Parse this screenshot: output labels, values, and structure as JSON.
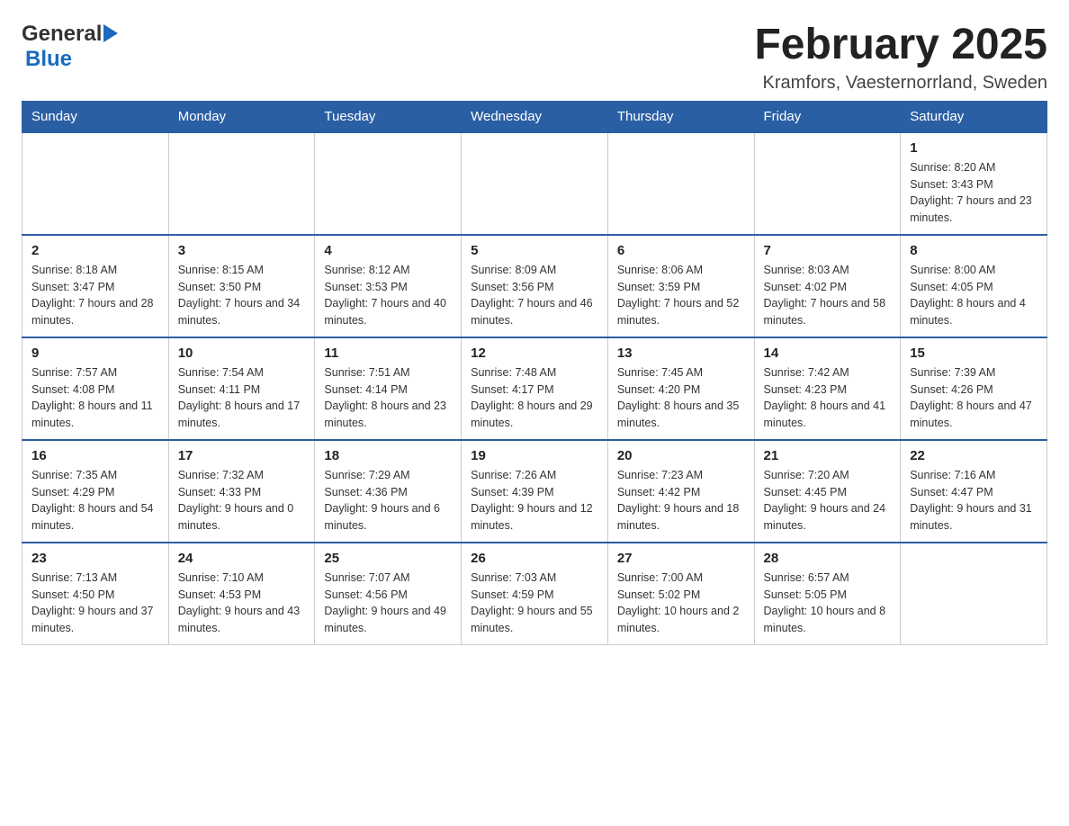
{
  "header": {
    "logo_general": "General",
    "logo_blue": "Blue",
    "month_title": "February 2025",
    "location": "Kramfors, Vaesternorrland, Sweden"
  },
  "weekdays": [
    "Sunday",
    "Monday",
    "Tuesday",
    "Wednesday",
    "Thursday",
    "Friday",
    "Saturday"
  ],
  "weeks": [
    [
      {
        "day": "",
        "sunrise": "",
        "sunset": "",
        "daylight": ""
      },
      {
        "day": "",
        "sunrise": "",
        "sunset": "",
        "daylight": ""
      },
      {
        "day": "",
        "sunrise": "",
        "sunset": "",
        "daylight": ""
      },
      {
        "day": "",
        "sunrise": "",
        "sunset": "",
        "daylight": ""
      },
      {
        "day": "",
        "sunrise": "",
        "sunset": "",
        "daylight": ""
      },
      {
        "day": "",
        "sunrise": "",
        "sunset": "",
        "daylight": ""
      },
      {
        "day": "1",
        "sunrise": "Sunrise: 8:20 AM",
        "sunset": "Sunset: 3:43 PM",
        "daylight": "Daylight: 7 hours and 23 minutes."
      }
    ],
    [
      {
        "day": "2",
        "sunrise": "Sunrise: 8:18 AM",
        "sunset": "Sunset: 3:47 PM",
        "daylight": "Daylight: 7 hours and 28 minutes."
      },
      {
        "day": "3",
        "sunrise": "Sunrise: 8:15 AM",
        "sunset": "Sunset: 3:50 PM",
        "daylight": "Daylight: 7 hours and 34 minutes."
      },
      {
        "day": "4",
        "sunrise": "Sunrise: 8:12 AM",
        "sunset": "Sunset: 3:53 PM",
        "daylight": "Daylight: 7 hours and 40 minutes."
      },
      {
        "day": "5",
        "sunrise": "Sunrise: 8:09 AM",
        "sunset": "Sunset: 3:56 PM",
        "daylight": "Daylight: 7 hours and 46 minutes."
      },
      {
        "day": "6",
        "sunrise": "Sunrise: 8:06 AM",
        "sunset": "Sunset: 3:59 PM",
        "daylight": "Daylight: 7 hours and 52 minutes."
      },
      {
        "day": "7",
        "sunrise": "Sunrise: 8:03 AM",
        "sunset": "Sunset: 4:02 PM",
        "daylight": "Daylight: 7 hours and 58 minutes."
      },
      {
        "day": "8",
        "sunrise": "Sunrise: 8:00 AM",
        "sunset": "Sunset: 4:05 PM",
        "daylight": "Daylight: 8 hours and 4 minutes."
      }
    ],
    [
      {
        "day": "9",
        "sunrise": "Sunrise: 7:57 AM",
        "sunset": "Sunset: 4:08 PM",
        "daylight": "Daylight: 8 hours and 11 minutes."
      },
      {
        "day": "10",
        "sunrise": "Sunrise: 7:54 AM",
        "sunset": "Sunset: 4:11 PM",
        "daylight": "Daylight: 8 hours and 17 minutes."
      },
      {
        "day": "11",
        "sunrise": "Sunrise: 7:51 AM",
        "sunset": "Sunset: 4:14 PM",
        "daylight": "Daylight: 8 hours and 23 minutes."
      },
      {
        "day": "12",
        "sunrise": "Sunrise: 7:48 AM",
        "sunset": "Sunset: 4:17 PM",
        "daylight": "Daylight: 8 hours and 29 minutes."
      },
      {
        "day": "13",
        "sunrise": "Sunrise: 7:45 AM",
        "sunset": "Sunset: 4:20 PM",
        "daylight": "Daylight: 8 hours and 35 minutes."
      },
      {
        "day": "14",
        "sunrise": "Sunrise: 7:42 AM",
        "sunset": "Sunset: 4:23 PM",
        "daylight": "Daylight: 8 hours and 41 minutes."
      },
      {
        "day": "15",
        "sunrise": "Sunrise: 7:39 AM",
        "sunset": "Sunset: 4:26 PM",
        "daylight": "Daylight: 8 hours and 47 minutes."
      }
    ],
    [
      {
        "day": "16",
        "sunrise": "Sunrise: 7:35 AM",
        "sunset": "Sunset: 4:29 PM",
        "daylight": "Daylight: 8 hours and 54 minutes."
      },
      {
        "day": "17",
        "sunrise": "Sunrise: 7:32 AM",
        "sunset": "Sunset: 4:33 PM",
        "daylight": "Daylight: 9 hours and 0 minutes."
      },
      {
        "day": "18",
        "sunrise": "Sunrise: 7:29 AM",
        "sunset": "Sunset: 4:36 PM",
        "daylight": "Daylight: 9 hours and 6 minutes."
      },
      {
        "day": "19",
        "sunrise": "Sunrise: 7:26 AM",
        "sunset": "Sunset: 4:39 PM",
        "daylight": "Daylight: 9 hours and 12 minutes."
      },
      {
        "day": "20",
        "sunrise": "Sunrise: 7:23 AM",
        "sunset": "Sunset: 4:42 PM",
        "daylight": "Daylight: 9 hours and 18 minutes."
      },
      {
        "day": "21",
        "sunrise": "Sunrise: 7:20 AM",
        "sunset": "Sunset: 4:45 PM",
        "daylight": "Daylight: 9 hours and 24 minutes."
      },
      {
        "day": "22",
        "sunrise": "Sunrise: 7:16 AM",
        "sunset": "Sunset: 4:47 PM",
        "daylight": "Daylight: 9 hours and 31 minutes."
      }
    ],
    [
      {
        "day": "23",
        "sunrise": "Sunrise: 7:13 AM",
        "sunset": "Sunset: 4:50 PM",
        "daylight": "Daylight: 9 hours and 37 minutes."
      },
      {
        "day": "24",
        "sunrise": "Sunrise: 7:10 AM",
        "sunset": "Sunset: 4:53 PM",
        "daylight": "Daylight: 9 hours and 43 minutes."
      },
      {
        "day": "25",
        "sunrise": "Sunrise: 7:07 AM",
        "sunset": "Sunset: 4:56 PM",
        "daylight": "Daylight: 9 hours and 49 minutes."
      },
      {
        "day": "26",
        "sunrise": "Sunrise: 7:03 AM",
        "sunset": "Sunset: 4:59 PM",
        "daylight": "Daylight: 9 hours and 55 minutes."
      },
      {
        "day": "27",
        "sunrise": "Sunrise: 7:00 AM",
        "sunset": "Sunset: 5:02 PM",
        "daylight": "Daylight: 10 hours and 2 minutes."
      },
      {
        "day": "28",
        "sunrise": "Sunrise: 6:57 AM",
        "sunset": "Sunset: 5:05 PM",
        "daylight": "Daylight: 10 hours and 8 minutes."
      },
      {
        "day": "",
        "sunrise": "",
        "sunset": "",
        "daylight": ""
      }
    ]
  ]
}
